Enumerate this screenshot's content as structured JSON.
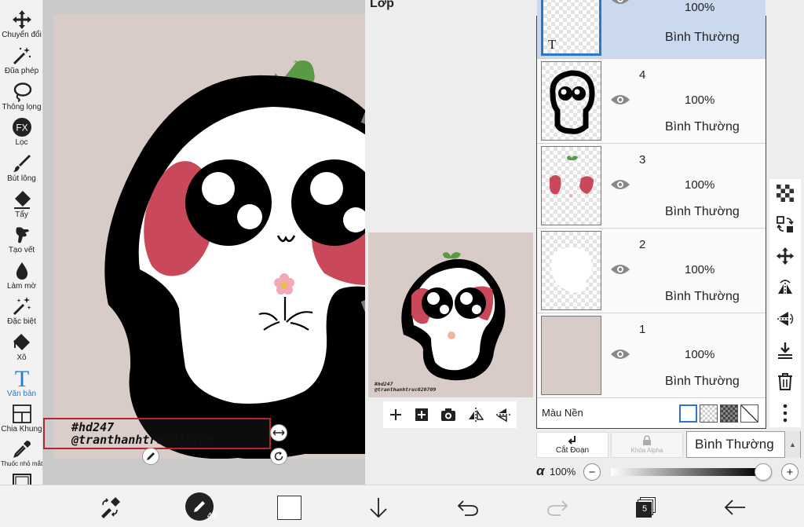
{
  "tools": [
    {
      "label": "Chuyển đổi",
      "icon": "move-arrows-icon"
    },
    {
      "label": "Đũa phép",
      "icon": "magic-wand-icon"
    },
    {
      "label": "Thông lọng",
      "icon": "lasso-icon"
    },
    {
      "label": "Lọc",
      "icon": "fx-filter-icon",
      "glyph": "FX"
    },
    {
      "label": "Bút lông",
      "icon": "brush-icon"
    },
    {
      "label": "Tẩy",
      "icon": "eraser-icon"
    },
    {
      "label": "Tạo vết",
      "icon": "smudge-icon"
    },
    {
      "label": "Làm mờ",
      "icon": "blur-drop-icon"
    },
    {
      "label": "Đặc biệt",
      "icon": "special-brush-icon"
    },
    {
      "label": "Xô",
      "icon": "bucket-icon"
    },
    {
      "label": "Văn bản",
      "icon": "text-tool-icon",
      "glyph": "T",
      "active": true
    },
    {
      "label": "Chia Khung",
      "icon": "frame-divider-icon"
    },
    {
      "label": "Thuốc nhỏ mắt",
      "icon": "eyedropper-icon"
    },
    {
      "label": "Tấm vải",
      "icon": "canvas-icon"
    }
  ],
  "canvas": {
    "text_line1": "#hd247",
    "text_line2": "@tranthanhtruc020709"
  },
  "layers_panel": {
    "title": "Lớp",
    "preview_caption_line1": "#hd247",
    "preview_caption_line2": "@tranthanhtruc020709",
    "layers": [
      {
        "number": "",
        "opacity": "100%",
        "mode": "Bình Thường",
        "selected": true,
        "thumb_glyph": "T"
      },
      {
        "number": "4",
        "opacity": "100%",
        "mode": "Bình Thường"
      },
      {
        "number": "3",
        "opacity": "100%",
        "mode": "Bình Thường"
      },
      {
        "number": "2",
        "opacity": "100%",
        "mode": "Bình Thường"
      },
      {
        "number": "1",
        "opacity": "100%",
        "mode": "Bình Thường"
      }
    ],
    "background_label": "Màu Nền",
    "clipping_label": "Cắt Đoạn",
    "alpha_lock_label": "Khóa Alpha",
    "blend_mode": "Bình Thường",
    "alpha_symbol": "α",
    "opacity_value": "100%",
    "minus": "−",
    "plus": "+"
  },
  "bottom_bar": {
    "brush_size": "44",
    "layer_count": "5"
  },
  "colors": {
    "accent": "#1e7be0",
    "selected_layer": "#cad9ee",
    "artwork_bg": "#d9cbc8",
    "blush": "#c9485a",
    "leaf": "#5a9a44",
    "textbox_border": "#b3262e"
  }
}
